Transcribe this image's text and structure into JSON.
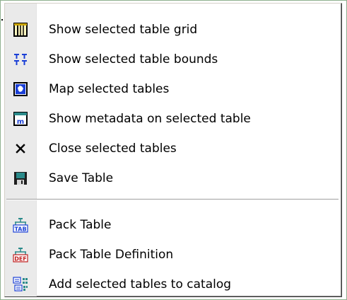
{
  "menu": {
    "items": [
      {
        "label": "Show selected table grid",
        "icon": "table-grid-icon"
      },
      {
        "label": "Show selected table bounds",
        "icon": "table-bounds-icon"
      },
      {
        "label": "Map selected tables",
        "icon": "map-icon"
      },
      {
        "label": "Show metadata on selected table",
        "icon": "metadata-icon"
      },
      {
        "label": "Close selected tables",
        "icon": "close-icon"
      },
      {
        "label": "Save Table",
        "icon": "save-icon"
      },
      {
        "label": "Pack Table",
        "icon": "pack-table-icon"
      },
      {
        "label": "Pack Table Definition",
        "icon": "pack-table-definition-icon"
      },
      {
        "label": "Add selected tables to catalog",
        "icon": "add-to-catalog-icon"
      }
    ]
  },
  "colors": {
    "gutter": "#eaeaea",
    "frame": "#8fb08f",
    "icon_blue": "#1a3fd6",
    "icon_teal": "#2a8a8a",
    "icon_dark": "#000000"
  }
}
